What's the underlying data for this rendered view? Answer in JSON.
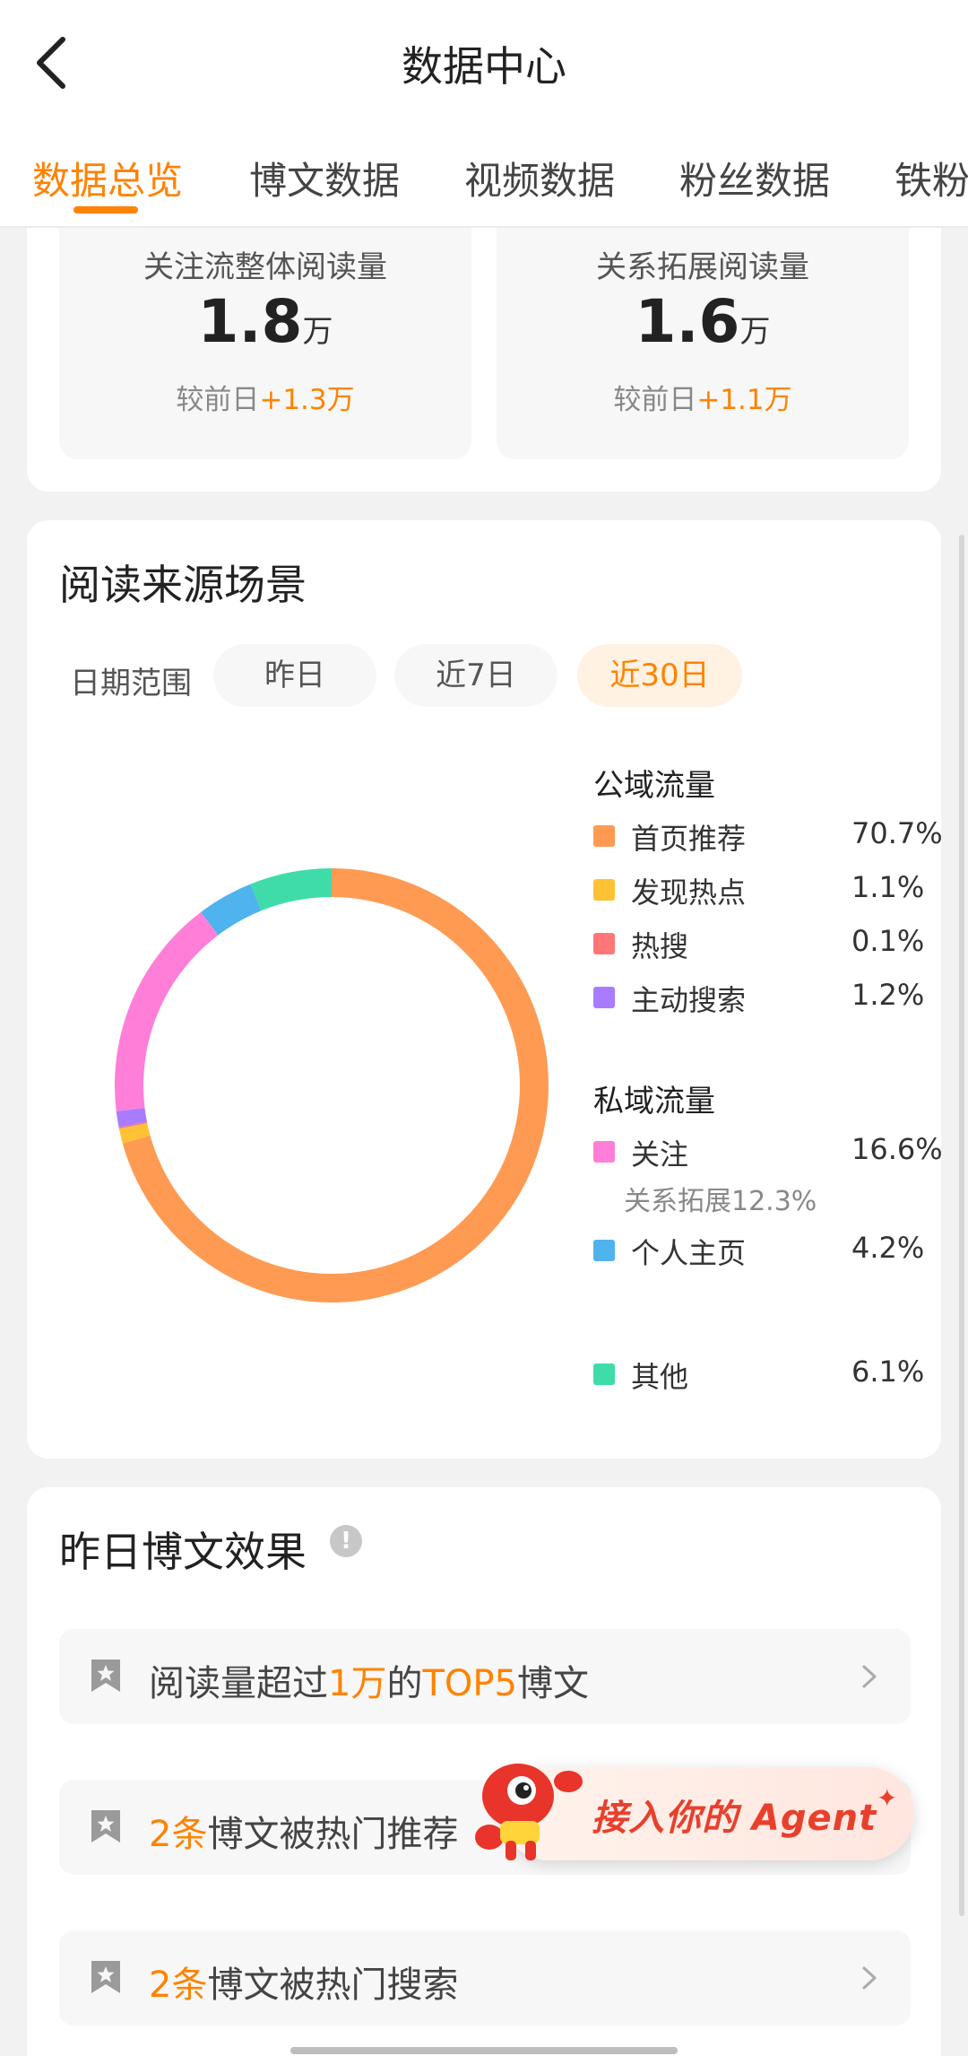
{
  "header": {
    "title": "数据中心",
    "back_icon": "chevron-left-icon"
  },
  "tabs": [
    {
      "label": "数据总览",
      "active": true
    },
    {
      "label": "博文数据"
    },
    {
      "label": "视频数据"
    },
    {
      "label": "粉丝数据"
    },
    {
      "label": "铁粉"
    }
  ],
  "reads": {
    "follow": {
      "label": "关注流整体阅读量",
      "value": "1.8",
      "unit": "万",
      "compare_prefix": "较前日",
      "compare_delta": "+1.3万"
    },
    "relation": {
      "label": "关系拓展阅读量",
      "value": "1.6",
      "unit": "万",
      "compare_prefix": "较前日",
      "compare_delta": "+1.1万"
    }
  },
  "source": {
    "title": "阅读来源场景",
    "range_label": "日期范围",
    "ranges": [
      {
        "label": "昨日"
      },
      {
        "label": "近7日"
      },
      {
        "label": "近30日",
        "active": true
      }
    ],
    "public_title": "公域流量",
    "private_title": "私域流量"
  },
  "chart_data": {
    "type": "pie",
    "categories": [
      "首页推荐",
      "发现热点",
      "热搜",
      "主动搜索",
      "关注",
      "个人主页",
      "其他"
    ],
    "labels": [
      "70.7%",
      "1.1%",
      "0.1%",
      "1.2%",
      "16.6%",
      "4.2%",
      "6.1%"
    ],
    "values": [
      70.7,
      1.1,
      0.1,
      1.2,
      16.6,
      4.2,
      6.1
    ],
    "colors": [
      "#ff9a52",
      "#ffc234",
      "#ff7676",
      "#a97cff",
      "#ff7ed7",
      "#4fb3ee",
      "#3fdcaa"
    ],
    "sub_note": "关系拓展12.3%"
  },
  "effect": {
    "title": "昨日博文效果",
    "info_icon": "!",
    "row1": {
      "pre": "阅读量超过",
      "hl1": "1万",
      "mid": "的",
      "hl2": "TOP5",
      "post": "博文"
    },
    "row2": {
      "hl": "2条",
      "post": "博文被热门推荐"
    },
    "row3": {
      "hl": "2条",
      "post": "博文被热门搜索"
    }
  },
  "agent": {
    "label": "接入你的 Agent",
    "sparkle": "✦"
  }
}
